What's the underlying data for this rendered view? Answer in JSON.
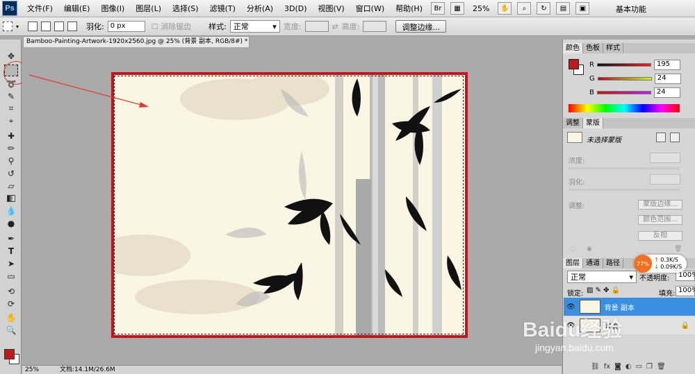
{
  "menubar": {
    "app_icon": "Ps",
    "items": [
      "文件(F)",
      "编辑(E)",
      "图像(I)",
      "图层(L)",
      "选择(S)",
      "滤镜(T)",
      "分析(A)",
      "3D(D)",
      "视图(V)",
      "窗口(W)",
      "帮助(H)"
    ],
    "bridge": "Br",
    "zoom": "25%",
    "workspace": "基本功能"
  },
  "options": {
    "feather_label": "羽化:",
    "feather_value": "0 px",
    "antialias_label": "消除锯齿",
    "style_label": "样式:",
    "style_value": "正常",
    "width_label": "宽度:",
    "height_label": "高度:",
    "refine_button": "调整边缘..."
  },
  "document": {
    "tab_title": "Bamboo-Painting-Artwork-1920x2560.jpg @ 25% (背景 副本, RGB/8#) *",
    "zoom": "25%",
    "doc_info": "文档:14.1M/26.6M"
  },
  "color_panel": {
    "tabs": [
      "颜色",
      "色板",
      "样式"
    ],
    "channels": [
      {
        "label": "R",
        "value": "195"
      },
      {
        "label": "G",
        "value": "24"
      },
      {
        "label": "B",
        "value": "24"
      }
    ],
    "foreground": "#c31818"
  },
  "masks_panel": {
    "tabs": [
      "调整",
      "蒙版"
    ],
    "no_mask": "未选择蒙版",
    "density": "浓度:",
    "feather": "羽化:",
    "refine": "调整:",
    "btn_edge": "蒙版边缘...",
    "btn_range": "颜色范围...",
    "btn_invert": "反相"
  },
  "layers_panel": {
    "tabs": [
      "图层",
      "通道",
      "路径"
    ],
    "blend": "正常",
    "opacity_label": "不透明度:",
    "opacity": "100%",
    "lock_label": "锁定:",
    "fill_label": "填充:",
    "fill": "100%",
    "layers": [
      {
        "name": "背景 副本",
        "selected": true
      },
      {
        "name": "背景",
        "selected": false
      }
    ]
  },
  "net_meter": {
    "percent": "77%",
    "up": "0.3K/S",
    "down": "0.09K/S"
  },
  "watermark": {
    "brand": "Baidu经验",
    "url": "jingyan.baidu.com"
  }
}
